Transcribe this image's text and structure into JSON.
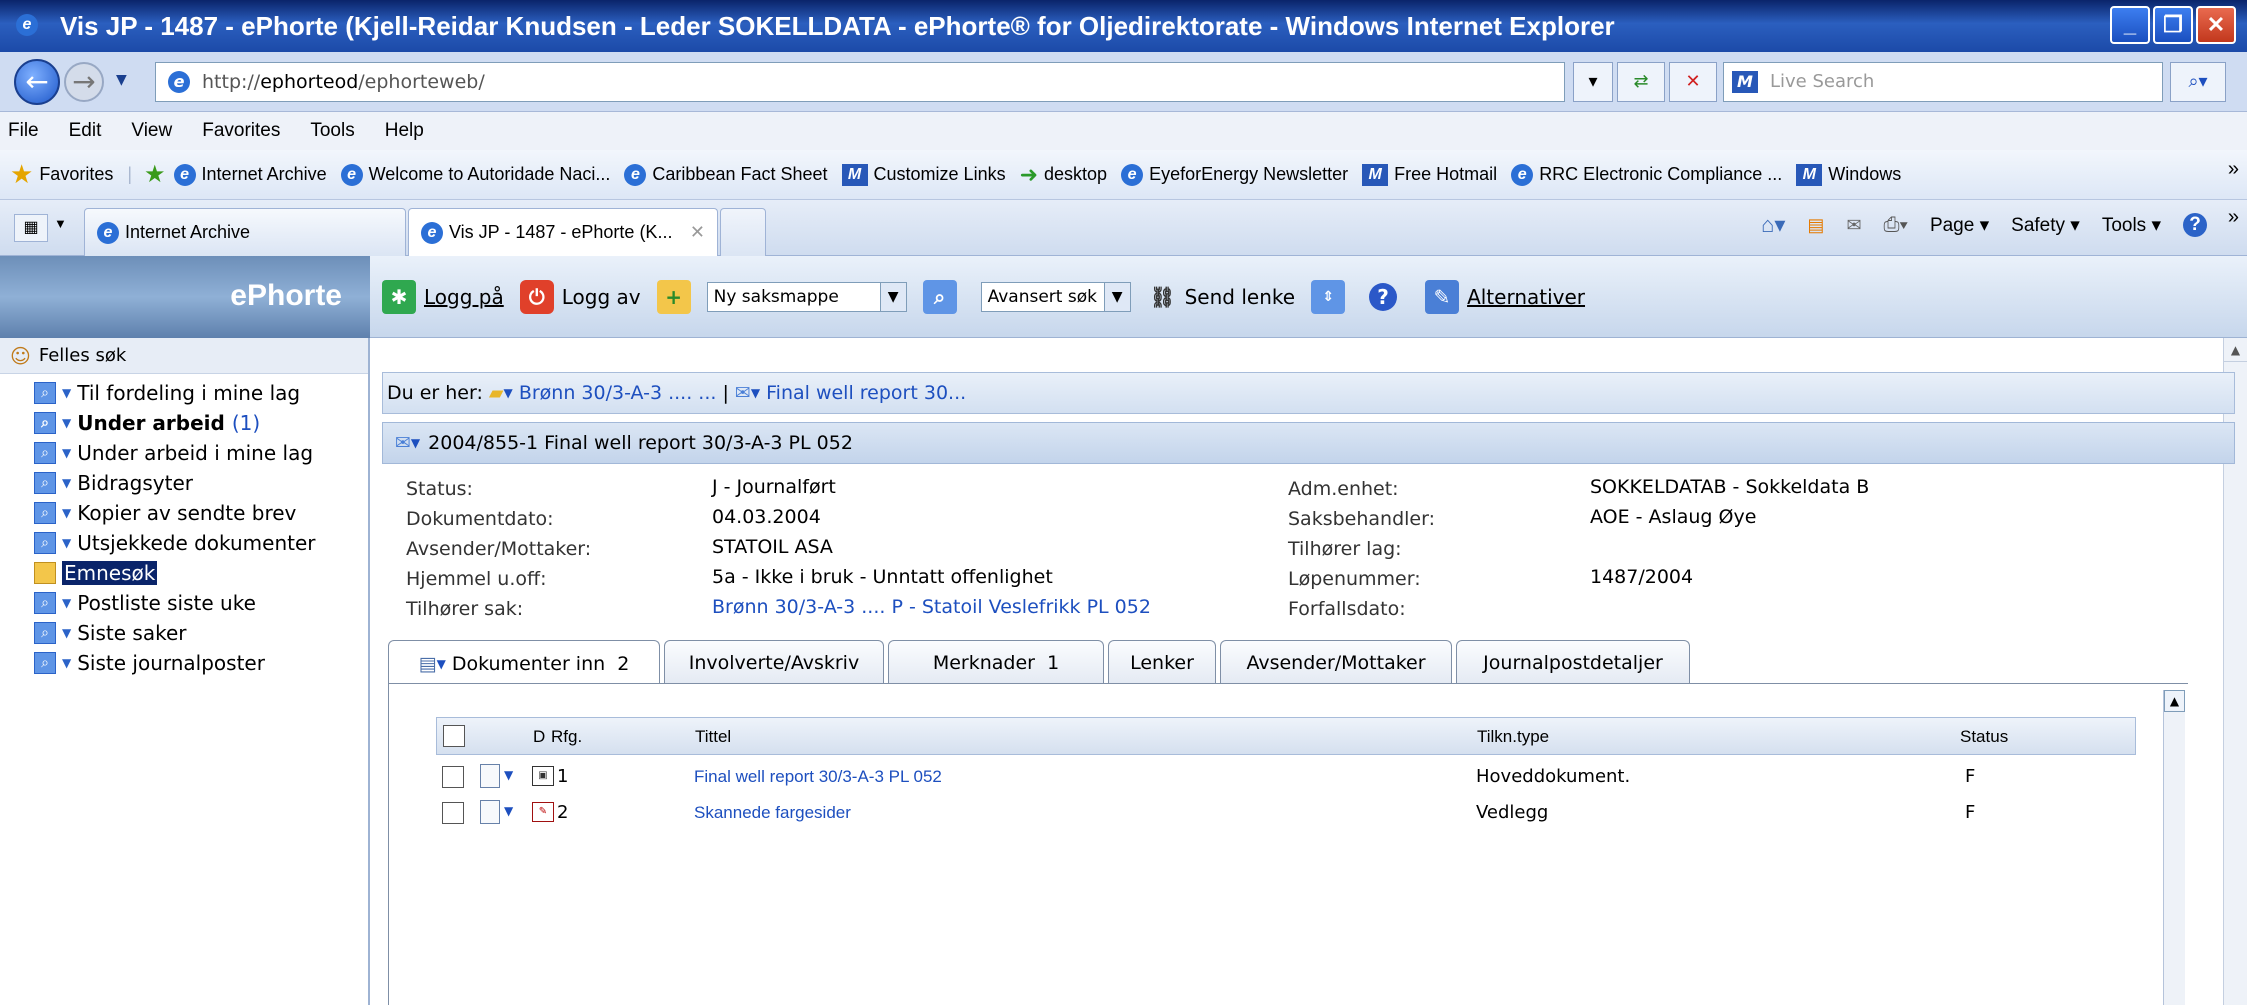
{
  "window": {
    "title": "Vis JP - 1487 - ePhorte (Kjell-Reidar Knudsen - Leder SOKELLDATA - ePhorte® for Oljedirektorate - Windows Internet Explorer"
  },
  "address": {
    "url_prefix": "http://",
    "url_host": "ephorteod",
    "url_path": "/ephorteweb/",
    "search_placeholder": "Live Search"
  },
  "menu": [
    "File",
    "Edit",
    "View",
    "Favorites",
    "Tools",
    "Help"
  ],
  "favorites": {
    "label": "Favorites",
    "links": [
      "Internet Archive",
      "Welcome to Autoridade Naci...",
      "Caribbean Fact Sheet",
      "Customize Links",
      "desktop",
      "EyeforEnergy Newsletter",
      "Free Hotmail",
      "RRC Electronic Compliance ...",
      "Windows"
    ]
  },
  "tabs": {
    "first": "Internet Archive",
    "second": "Vis JP - 1487 - ePhorte (K...",
    "commands": [
      "Page ▾",
      "Safety ▾",
      "Tools ▾"
    ]
  },
  "app": {
    "logo": "ePhorte",
    "toolbar": {
      "login": "Logg på",
      "logout": "Logg av",
      "new_select": "Ny saksmappe",
      "adv_search": "Avansert søk",
      "send_link": "Send lenke",
      "alternatives": "Alternativer"
    }
  },
  "sidebar": {
    "header": "Felles søk",
    "items": [
      {
        "label": "Til fordeling i mine lag",
        "count": ""
      },
      {
        "label": "Under arbeid",
        "count": "(1)"
      },
      {
        "label": "Under arbeid i mine lag",
        "count": ""
      },
      {
        "label": "Bidragsyter",
        "count": ""
      },
      {
        "label": "Kopier av sendte brev",
        "count": ""
      },
      {
        "label": "Utsjekkede dokumenter",
        "count": ""
      },
      {
        "label": "Emnesøk",
        "count": ""
      },
      {
        "label": "Postliste siste uke",
        "count": ""
      },
      {
        "label": "Siste saker",
        "count": ""
      },
      {
        "label": "Siste journalposter",
        "count": ""
      }
    ]
  },
  "breadcrumb": {
    "prefix": "Du er her:",
    "item1": "Brønn 30/3-A-3 .... ...",
    "separator": "|",
    "item2": "Final well report 30..."
  },
  "journalpost": {
    "header": "2004/855-1  Final well report 30/3-A-3 PL 052",
    "left": [
      {
        "label": "Status:",
        "value": "J - Journalført"
      },
      {
        "label": "Dokumentdato:",
        "value": "04.03.2004"
      },
      {
        "label": "Avsender/Mottaker:",
        "value": "STATOIL ASA"
      },
      {
        "label": "Hjemmel u.off:",
        "value": "5a - Ikke i bruk - Unntatt offenlighet"
      },
      {
        "label": "Tilhører sak:",
        "value": "Brønn 30/3-A-3 .... P - Statoil Veslefrikk PL 052"
      }
    ],
    "right": [
      {
        "label": "Adm.enhet:",
        "value": "SOKKELDATAB - Sokkeldata B"
      },
      {
        "label": "Saksbehandler:",
        "value": "AOE - Aslaug Øye"
      },
      {
        "label": "Tilhører lag:",
        "value": ""
      },
      {
        "label": "Løpenummer:",
        "value": "1487/2004"
      },
      {
        "label": "Forfallsdato:",
        "value": ""
      }
    ]
  },
  "doc_tabs": [
    {
      "label": "Dokumenter inn",
      "count": "2"
    },
    {
      "label": "Involverte/Avskriv",
      "count": ""
    },
    {
      "label": "Merknader",
      "count": "1"
    },
    {
      "label": "Lenker",
      "count": ""
    },
    {
      "label": "Avsender/Mottaker",
      "count": ""
    },
    {
      "label": "Journalpostdetaljer",
      "count": ""
    }
  ],
  "doc_table": {
    "columns": {
      "d": "D",
      "rfg": "Rfg.",
      "tittel": "Tittel",
      "tilkn": "Tilkn.type",
      "status": "Status"
    },
    "rows": [
      {
        "rfg": "1",
        "tittel": "Final well report 30/3-A-3 PL 052",
        "tilkn": "Hoveddokument.",
        "status": "F"
      },
      {
        "rfg": "2",
        "tittel": "Skannede fargesider",
        "tilkn": "Vedlegg",
        "status": "F"
      }
    ]
  }
}
